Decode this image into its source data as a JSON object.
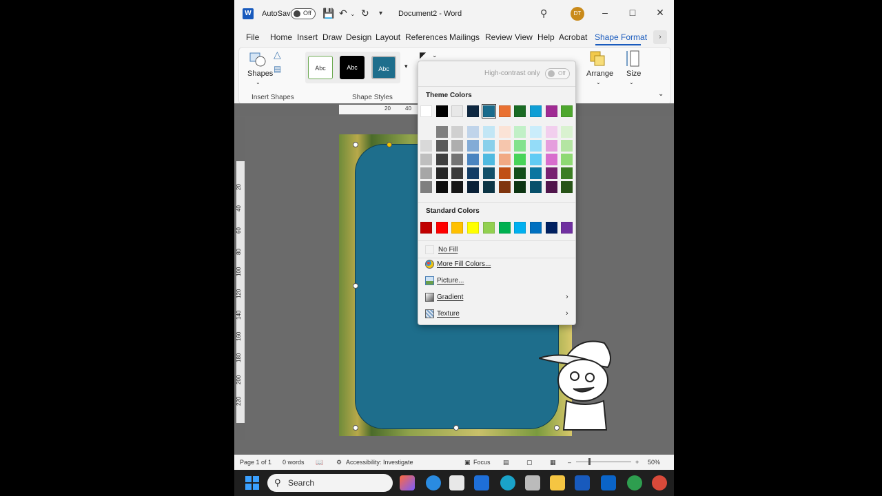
{
  "titlebar": {
    "autosave_label": "AutoSave",
    "autosave_state": "Off",
    "doc_title": "Document2 - Word",
    "avatar_initials": "DT"
  },
  "tabs": [
    "File",
    "Home",
    "Insert",
    "Draw",
    "Design",
    "Layout",
    "References",
    "Mailings",
    "Review",
    "View",
    "Help",
    "Acrobat",
    "Shape Format"
  ],
  "ribbon": {
    "shapes_label": "Shapes",
    "insert_shapes_group": "Insert Shapes",
    "shape_styles_group": "Shape Styles",
    "style_samples": [
      "Abc",
      "Abc",
      "Abc"
    ],
    "arrange_label": "Arrange",
    "size_label": "Size"
  },
  "ruler_numbers": [
    "20",
    "40"
  ],
  "vertical_ruler_numbers": [
    "20",
    "40",
    "60",
    "80",
    "100",
    "120",
    "140",
    "160",
    "180",
    "200",
    "220"
  ],
  "fill_menu": {
    "high_contrast_label": "High-contrast only",
    "high_contrast_state": "Off",
    "theme_colors_title": "Theme Colors",
    "standard_colors_title": "Standard Colors",
    "theme_colors": [
      "#ffffff",
      "#000000",
      "#e8e8e8",
      "#0e2841",
      "#196b8c",
      "#e97132",
      "#196b24",
      "#0f9ed5",
      "#a02b93",
      "#4ea72e"
    ],
    "theme_shades": [
      [
        "#f2f2f2",
        "#7f7f7f",
        "#d0d0d0",
        "#c0d4ea",
        "#c2e6f5",
        "#fbe3d6",
        "#c1f0c7",
        "#caedfb",
        "#f2cfee",
        "#d9f2d0"
      ],
      [
        "#d9d9d9",
        "#595959",
        "#aeaeae",
        "#83abd6",
        "#89d0eb",
        "#f6c6ad",
        "#83e28e",
        "#94dcf8",
        "#e59edd",
        "#b4e5a2"
      ],
      [
        "#bfbfbf",
        "#3f3f3f",
        "#747474",
        "#4a84c0",
        "#4fbae0",
        "#f1a983",
        "#47d459",
        "#61cbf4",
        "#d86dcd",
        "#8ed973"
      ],
      [
        "#a6a6a6",
        "#262626",
        "#3a3a3a",
        "#123c65",
        "#124f68",
        "#c04f15",
        "#124e1b",
        "#0b76a0",
        "#782070",
        "#3b7d23"
      ],
      [
        "#7f7f7f",
        "#0d0d0d",
        "#171717",
        "#0a2137",
        "#0c3545",
        "#7f350e",
        "#0c3412",
        "#074f6a",
        "#50154b",
        "#275317"
      ]
    ],
    "standard_colors": [
      "#c00000",
      "#ff0000",
      "#ffc000",
      "#ffff00",
      "#92d050",
      "#00b050",
      "#00b0f0",
      "#0070c0",
      "#002060",
      "#7030a0"
    ],
    "items": {
      "no_fill": "No Fill",
      "more_colors": "More Fill Colors...",
      "picture": "Picture...",
      "gradient": "Gradient",
      "texture": "Texture"
    }
  },
  "status": {
    "page": "Page 1 of 1",
    "words": "0 words",
    "accessibility": "Accessibility: Investigate",
    "focus": "Focus",
    "zoom": "50%"
  },
  "taskbar": {
    "search_placeholder": "Search"
  }
}
